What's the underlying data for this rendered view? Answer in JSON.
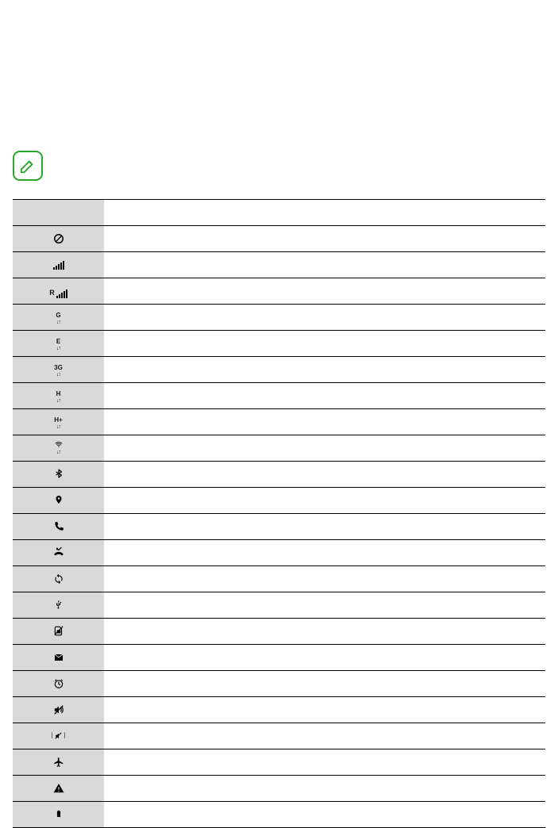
{
  "note": {
    "icon": "note-icon"
  },
  "table": {
    "header_icon": "",
    "header_desc": "",
    "rows": [
      {
        "icon": "no-signal",
        "desc": ""
      },
      {
        "icon": "signal",
        "desc": ""
      },
      {
        "icon": "roaming",
        "desc": ""
      },
      {
        "icon": "gprs",
        "desc": ""
      },
      {
        "icon": "edge",
        "desc": ""
      },
      {
        "icon": "3g",
        "desc": ""
      },
      {
        "icon": "hsdpa",
        "desc": ""
      },
      {
        "icon": "hsdpa-plus",
        "desc": ""
      },
      {
        "icon": "wifi",
        "desc": ""
      },
      {
        "icon": "bluetooth",
        "desc": ""
      },
      {
        "icon": "gps",
        "desc": ""
      },
      {
        "icon": "call",
        "desc": ""
      },
      {
        "icon": "missed-call",
        "desc": ""
      },
      {
        "icon": "sync",
        "desc": ""
      },
      {
        "icon": "usb",
        "desc": ""
      },
      {
        "icon": "no-sim",
        "desc": ""
      },
      {
        "icon": "message",
        "desc": ""
      },
      {
        "icon": "alarm",
        "desc": ""
      },
      {
        "icon": "silent",
        "desc": ""
      },
      {
        "icon": "vibrate",
        "desc": ""
      },
      {
        "icon": "flight-mode",
        "desc": ""
      },
      {
        "icon": "error",
        "desc": ""
      },
      {
        "icon": "battery",
        "desc": ""
      }
    ]
  }
}
